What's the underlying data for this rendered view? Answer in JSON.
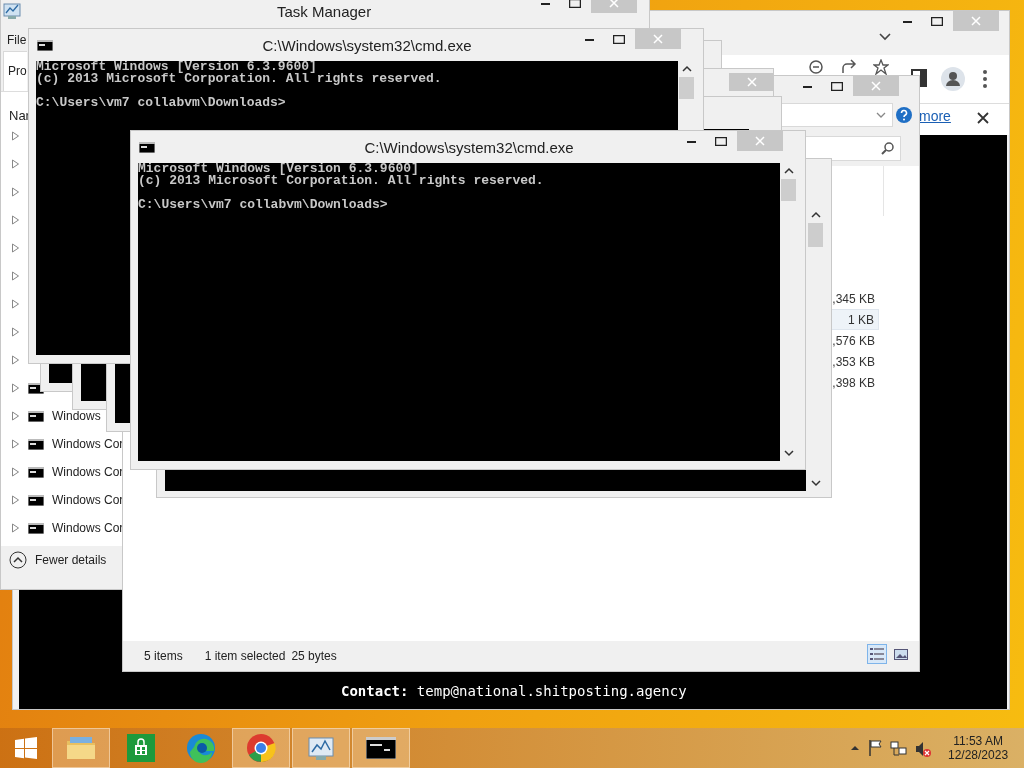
{
  "browser": {
    "infobar_link": "more",
    "page_text": "**Contact:** temp@national.shitposting.agency"
  },
  "task_manager": {
    "title": "Task Manager",
    "menu": [
      "File"
    ],
    "tabs": [
      {
        "label": "Pro",
        "selected": true
      }
    ],
    "column": "Nar",
    "rows": [
      {
        "kind": "covered",
        "expanded": false
      },
      {
        "kind": "covered",
        "expanded": false
      },
      {
        "kind": "covered",
        "expanded": false
      },
      {
        "kind": "covered",
        "expanded": false
      },
      {
        "kind": "covered",
        "expanded": false
      },
      {
        "kind": "covered",
        "expanded": false
      },
      {
        "kind": "covered",
        "expanded": false
      },
      {
        "kind": "covered",
        "expanded": false
      },
      {
        "kind": "covered",
        "expanded": false
      },
      {
        "kind": "process",
        "expanded": false
      },
      {
        "kind": "process",
        "label": "Windows",
        "expanded": false
      },
      {
        "kind": "process",
        "label": "Windows Cor",
        "expanded": false
      },
      {
        "kind": "process",
        "label": "Windows Cor",
        "expanded": false
      },
      {
        "kind": "process",
        "label": "Windows Cor",
        "expanded": false
      },
      {
        "kind": "process",
        "label": "Windows Cor",
        "expanded": false
      }
    ],
    "toggle": "Fewer details"
  },
  "explorer": {
    "sizes": [
      {
        "text": ",345 KB",
        "selected": false
      },
      {
        "text": "1 KB",
        "selected": true
      },
      {
        "text": ",576 KB",
        "selected": false
      },
      {
        "text": ",353 KB",
        "selected": false
      },
      {
        "text": ",398 KB",
        "selected": false
      }
    ],
    "status": {
      "count": "5 items",
      "selection": "1 item selected",
      "size": "25 bytes"
    },
    "views": [
      {
        "kind": "details",
        "selected": true
      },
      {
        "kind": "thumbnails",
        "selected": false
      }
    ]
  },
  "consoles": [
    {
      "title": "C:\\Windows\\system32\\cmd.exe",
      "output": [
        "Microsoft Windows [Version 6.3.9600]",
        "(c) 2013 Microsoft Corporation. All rights reserved."
      ],
      "prompt": "C:\\Users\\vm7 collabvm\\Downloads>"
    },
    {
      "title": "C:\\Windows\\system32\\cmd.exe",
      "output": [
        "Microsoft Windows [Version 6.3.9600]",
        "(c) 2013 Microsoft Corporation. All rights reserved."
      ],
      "prompt": "C:\\Users\\vm7 collabvm\\Downloads>"
    }
  ],
  "taskbar": {
    "apps": [
      {
        "kind": "start",
        "running": false
      },
      {
        "kind": "explorer",
        "running": true
      },
      {
        "kind": "store",
        "running": false
      },
      {
        "kind": "edge",
        "running": false
      },
      {
        "kind": "chrome",
        "running": true
      },
      {
        "kind": "monitor",
        "running": true
      },
      {
        "kind": "console",
        "running": true
      }
    ],
    "time": "11:53 AM",
    "date": "12/28/2023"
  }
}
